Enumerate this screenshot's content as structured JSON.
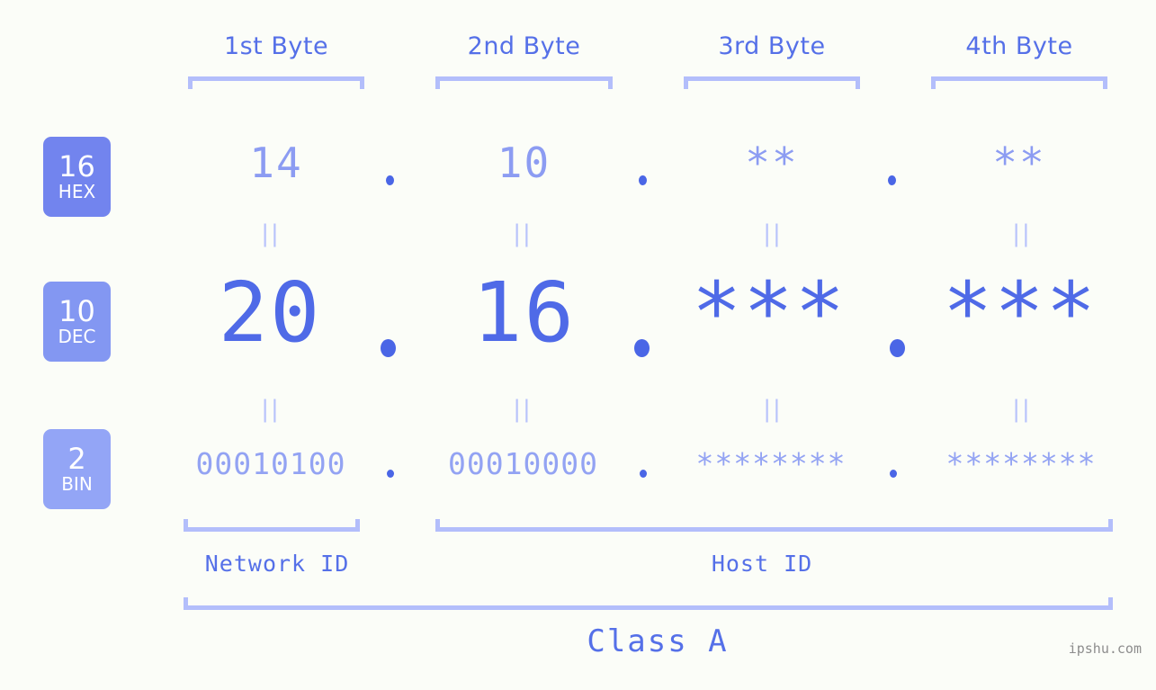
{
  "theme": {
    "background": "#fbfdf8",
    "accent_strong": "#5570e8",
    "accent_light": "#9aaaf5",
    "bracket": "#b3befb",
    "badge_hex_bg": "#7284ee",
    "badge_dec_bg": "#8397f2",
    "badge_bin_bg": "#93a5f6",
    "watermark_color": "#8d8d8d"
  },
  "byte_headers": [
    {
      "label": "1st Byte"
    },
    {
      "label": "2nd Byte"
    },
    {
      "label": "3rd Byte"
    },
    {
      "label": "4th Byte"
    }
  ],
  "bases": [
    {
      "number": "16",
      "name": "HEX"
    },
    {
      "number": "10",
      "name": "DEC"
    },
    {
      "number": "2",
      "name": "BIN"
    }
  ],
  "separator": ".",
  "equals_marker": "||",
  "rows": {
    "hex": {
      "base": "16",
      "name": "HEX",
      "octets": [
        "14",
        "10",
        "**",
        "**"
      ]
    },
    "dec": {
      "base": "10",
      "name": "DEC",
      "octets": [
        "20",
        "16",
        "***",
        "***"
      ]
    },
    "bin": {
      "base": "2",
      "name": "BIN",
      "octets": [
        "00010100",
        "00010000",
        "********",
        "********"
      ]
    }
  },
  "id_labels": {
    "network": "Network ID",
    "host": "Host ID"
  },
  "class_label": "Class A",
  "watermark": "ipshu.com"
}
